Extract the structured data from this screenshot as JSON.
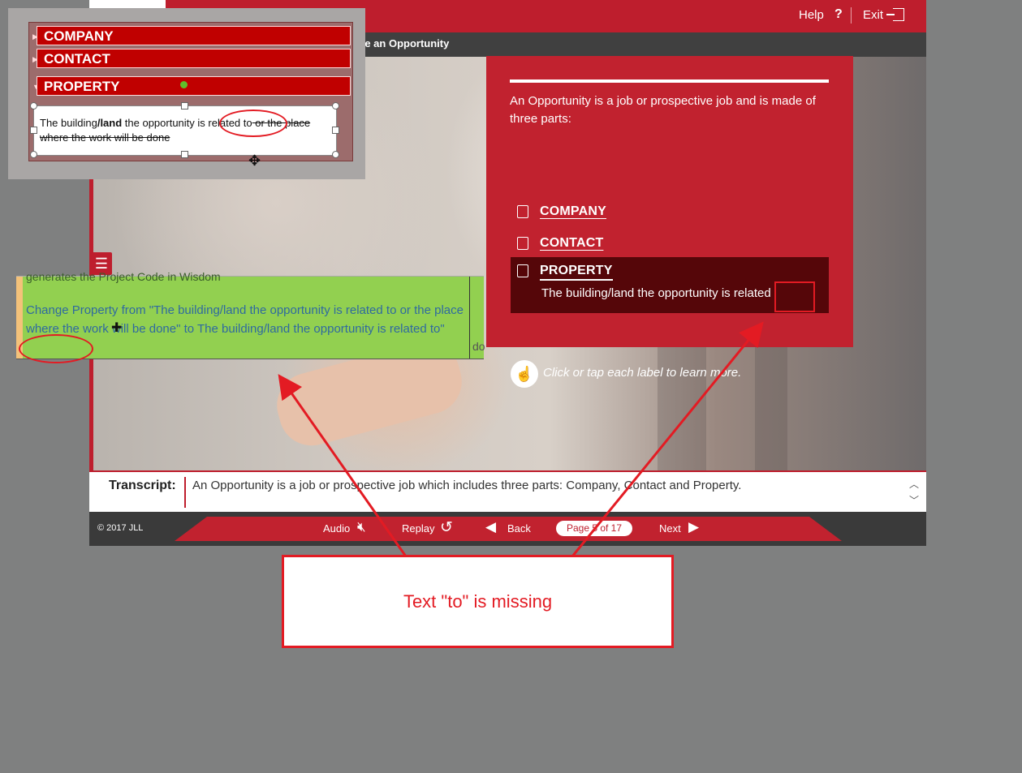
{
  "header": {
    "help_label": "Help",
    "help_icon": "?",
    "exit_label": "Exit",
    "lesson_title": "te an Opportunity"
  },
  "card": {
    "intro": "An Opportunity is a job or prospective job and is made of three parts:",
    "items": [
      {
        "label": "COMPANY",
        "icon": "building-icon"
      },
      {
        "label": "CONTACT",
        "icon": "contact-card-icon"
      },
      {
        "label": "PROPERTY",
        "icon": "property-icon",
        "description": "The building/land the opportunity is related"
      }
    ],
    "hint": "Click or tap each label to learn more."
  },
  "transcript": {
    "label": "Transcript:",
    "text": "An Opportunity is a job or prospective job which includes three parts: Company, Contact and Property."
  },
  "footer": {
    "copyright": "© 2017 JLL",
    "audio_label": "Audio",
    "replay_label": "Replay",
    "back_label": "Back",
    "page_indicator": "Page 5 of 17",
    "next_label": "Next"
  },
  "inset": {
    "rows": [
      "COMPANY",
      "CONTACT",
      "PROPERTY"
    ],
    "text_before": "The building",
    "text_bold": "/land",
    "text_mid": " the opportunity is related to",
    "text_struck": " or the place where the work will be done"
  },
  "changelog": {
    "previous_line": "generates the Project Code in Wisdom",
    "text": "Change Property from \"The building/land the opportunity is related to or the place where the work will be done\" to The building/land the opportunity is related to\"",
    "right_fragment": "do"
  },
  "callout": {
    "text": "Text \"to\" is missing"
  },
  "colors": {
    "brand_red": "#be1e2d",
    "dark_red": "#550609",
    "annotation_red": "#e31b23",
    "changelog_green": "#92d050"
  }
}
